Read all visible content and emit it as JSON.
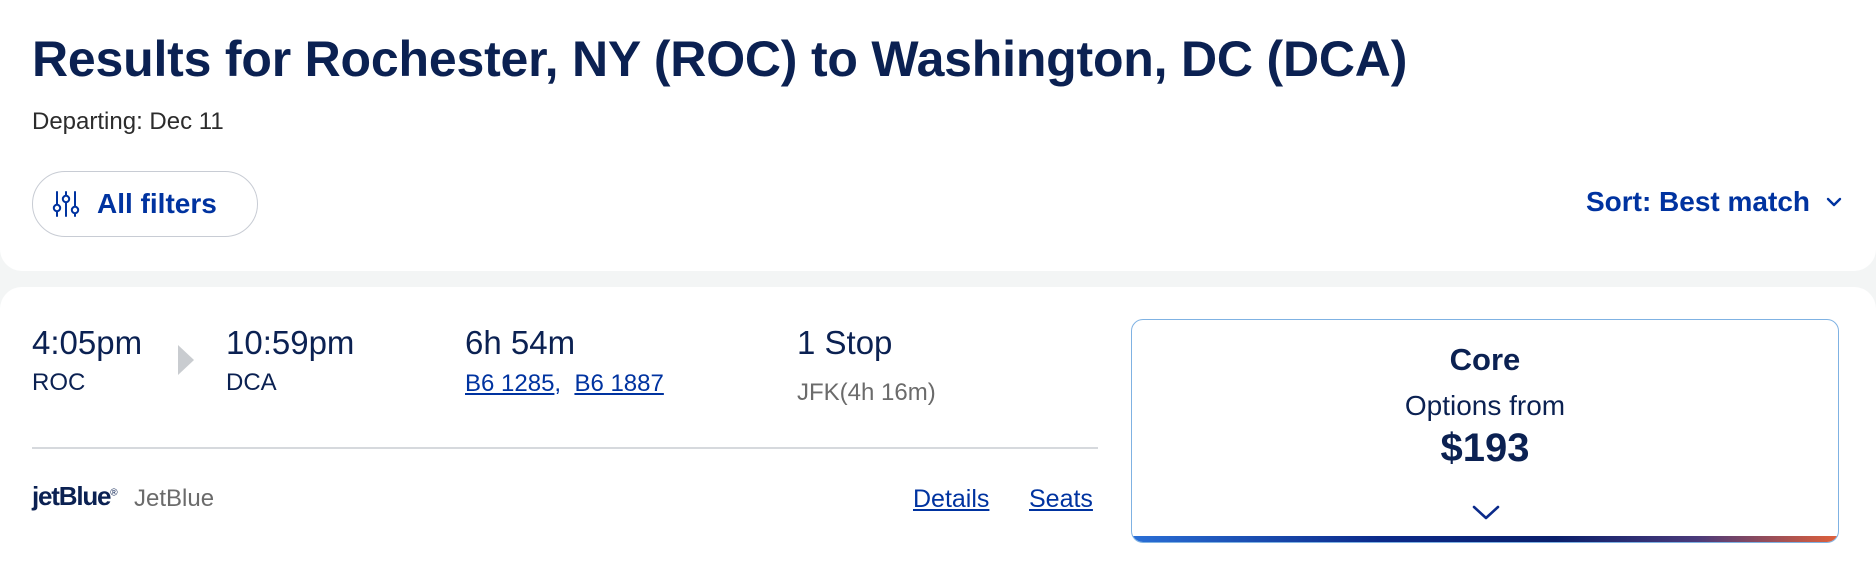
{
  "header": {
    "title": "Results for Rochester, NY (ROC) to Washington, DC (DCA)",
    "departing": "Departing: Dec 11"
  },
  "toolbar": {
    "filters_label": "All filters",
    "filters_icon": "sliders-icon",
    "sort_label": "Sort: Best match",
    "sort_icon": "chevron-down-icon"
  },
  "result": {
    "depart_time": "4:05pm",
    "depart_code": "ROC",
    "arrive_time": "10:59pm",
    "arrive_code": "DCA",
    "duration": "6h 54m",
    "flights": [
      "B6 1285",
      "B6 1887"
    ],
    "flight_separator": ",",
    "stops": "1 Stop",
    "stop_detail": "JFK(4h 16m)",
    "airline_logo": "jetBlue",
    "airline_name": "JetBlue",
    "details_label": "Details",
    "seats_label": "Seats"
  },
  "fare": {
    "name": "Core",
    "options_label": "Options from",
    "price": "$193"
  },
  "colors": {
    "navy": "#0b2152",
    "link_blue": "#0033a0",
    "fare_border": "#7fb2e3",
    "background": "#f3f5f5"
  }
}
